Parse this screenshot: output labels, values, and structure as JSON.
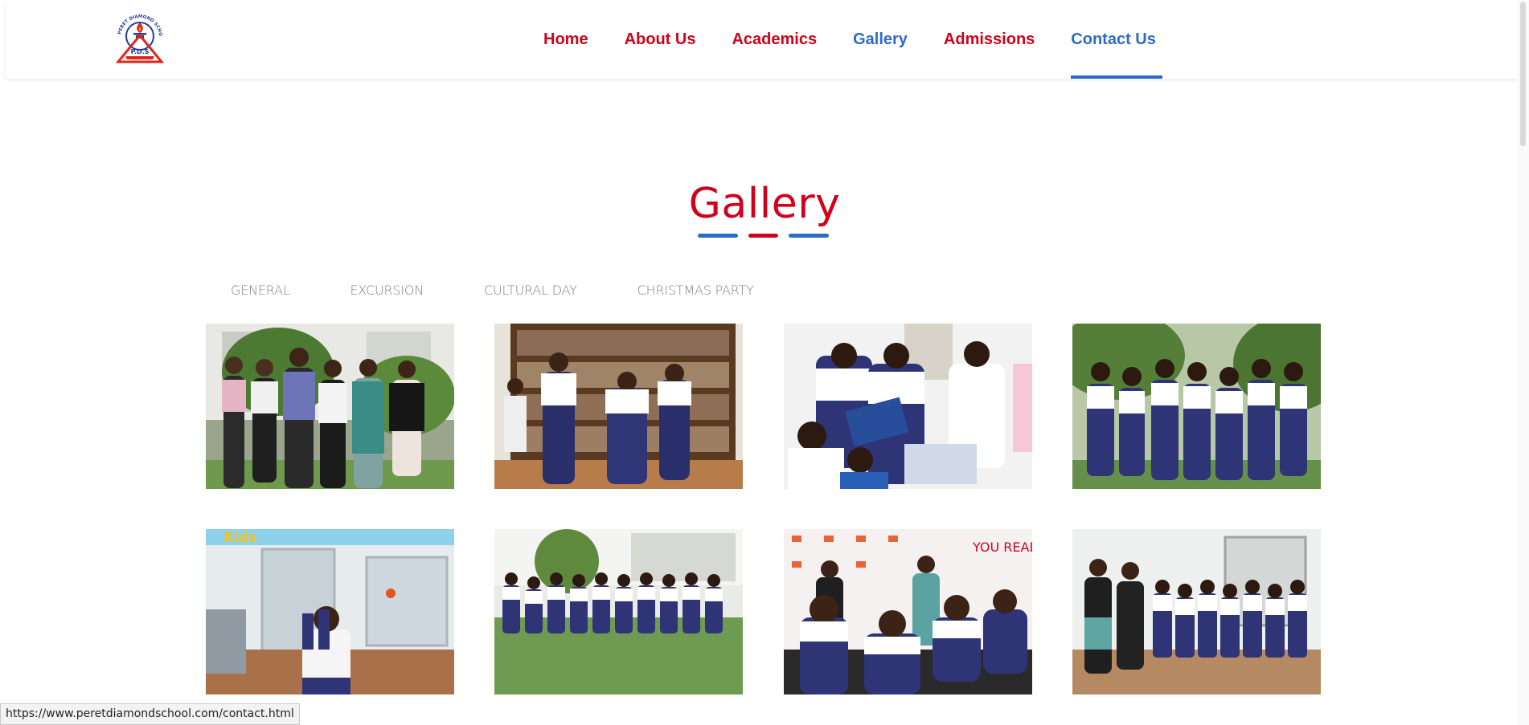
{
  "logo": {
    "arc_text": "PERET DIAMOND SCHOOL",
    "initials": "P.D.S"
  },
  "nav": {
    "items": [
      {
        "label": "Home"
      },
      {
        "label": "About Us"
      },
      {
        "label": "Academics"
      },
      {
        "label": "Gallery"
      },
      {
        "label": "Admissions"
      },
      {
        "label": "Contact Us"
      }
    ],
    "active_items": [
      "Gallery",
      "Contact Us"
    ]
  },
  "gallery": {
    "title": "Gallery",
    "tabs": [
      "GENERAL",
      "EXCURSION",
      "CULTURAL DAY",
      "CHRISTMAS PARTY"
    ],
    "photo_texts": {
      "kids_banner": "Kids",
      "you_read": "YOU READ"
    }
  },
  "status_bar": {
    "url": "https://www.peretdiamondschool.com/contact.html"
  },
  "colors": {
    "brand_red": "#d0021b",
    "accent_blue": "#2b6cc9",
    "tab_grey": "#808080"
  }
}
